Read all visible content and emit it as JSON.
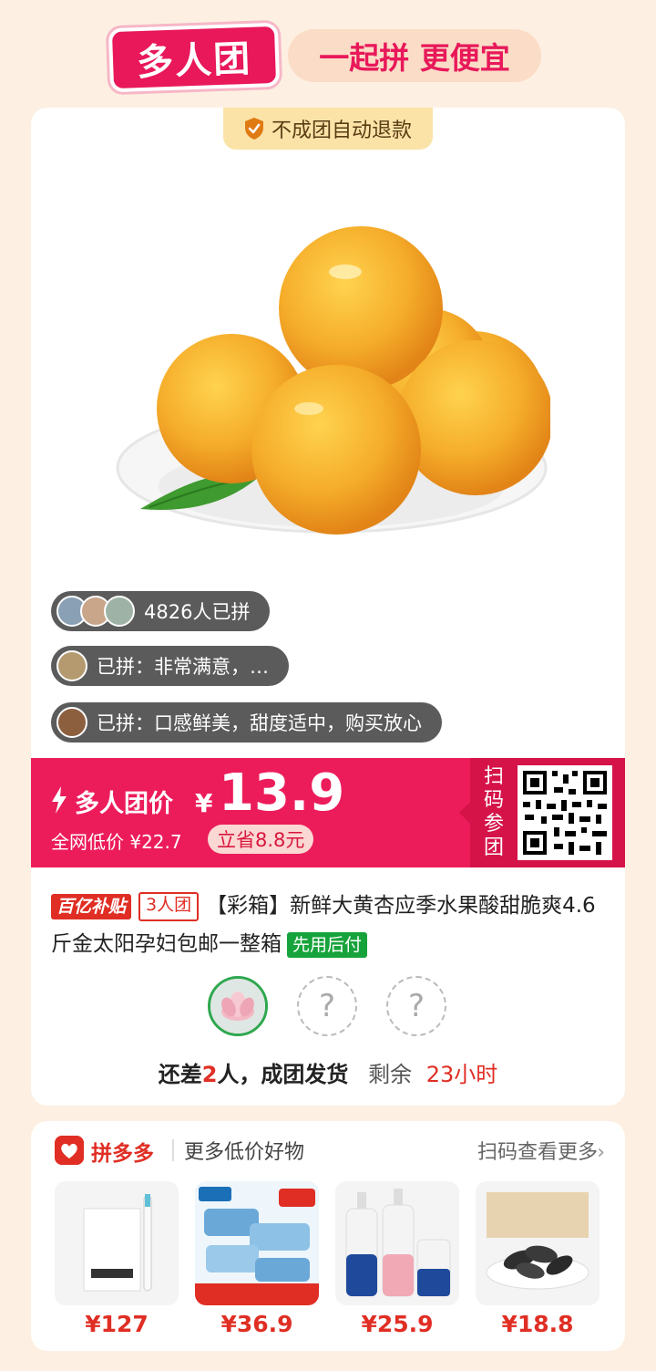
{
  "header": {
    "logo_text": "多人团",
    "slogan": "一起拼 更便宜"
  },
  "product": {
    "refund_badge": "不成团自动退款",
    "joined_count": "4826人已拼",
    "review_1": "已拼：非常满意，…",
    "review_2": "已拼：口感鲜美，甜度适中，购买放心",
    "price_label": "多人团价",
    "currency": "¥",
    "price": "13.9",
    "compare_price": "全网低价 ¥22.7",
    "save_badge": "立省8.8元",
    "qr_label": "扫码参团",
    "tag_subsidy": "百亿补贴",
    "tag_group": "3人团",
    "title": "【彩箱】新鲜大黄杏应季水果酸甜脆爽4.6斤金太阳孕妇包邮一整箱",
    "tag_paylater": "先用后付",
    "empty_slot": "?",
    "status_prefix": "还差",
    "status_count": "2",
    "status_suffix": "人，成团发货",
    "remaining_label": "剩余",
    "remaining_time": "23小时"
  },
  "more_section": {
    "brand": "拼多多",
    "subtitle": "更多低价好物",
    "link": "扫码查看更多",
    "items": [
      {
        "icon": "toothbrush-image",
        "price": "¥127"
      },
      {
        "icon": "wet-wipes-image",
        "price": "¥36.9"
      },
      {
        "icon": "shampoo-image",
        "price": "¥25.9"
      },
      {
        "icon": "melon-seeds-image",
        "price": "¥18.8"
      }
    ]
  },
  "colors": {
    "brand_pink": "#ec1c5b",
    "pdd_red": "#e02e24",
    "background": "#fdf0e2"
  }
}
